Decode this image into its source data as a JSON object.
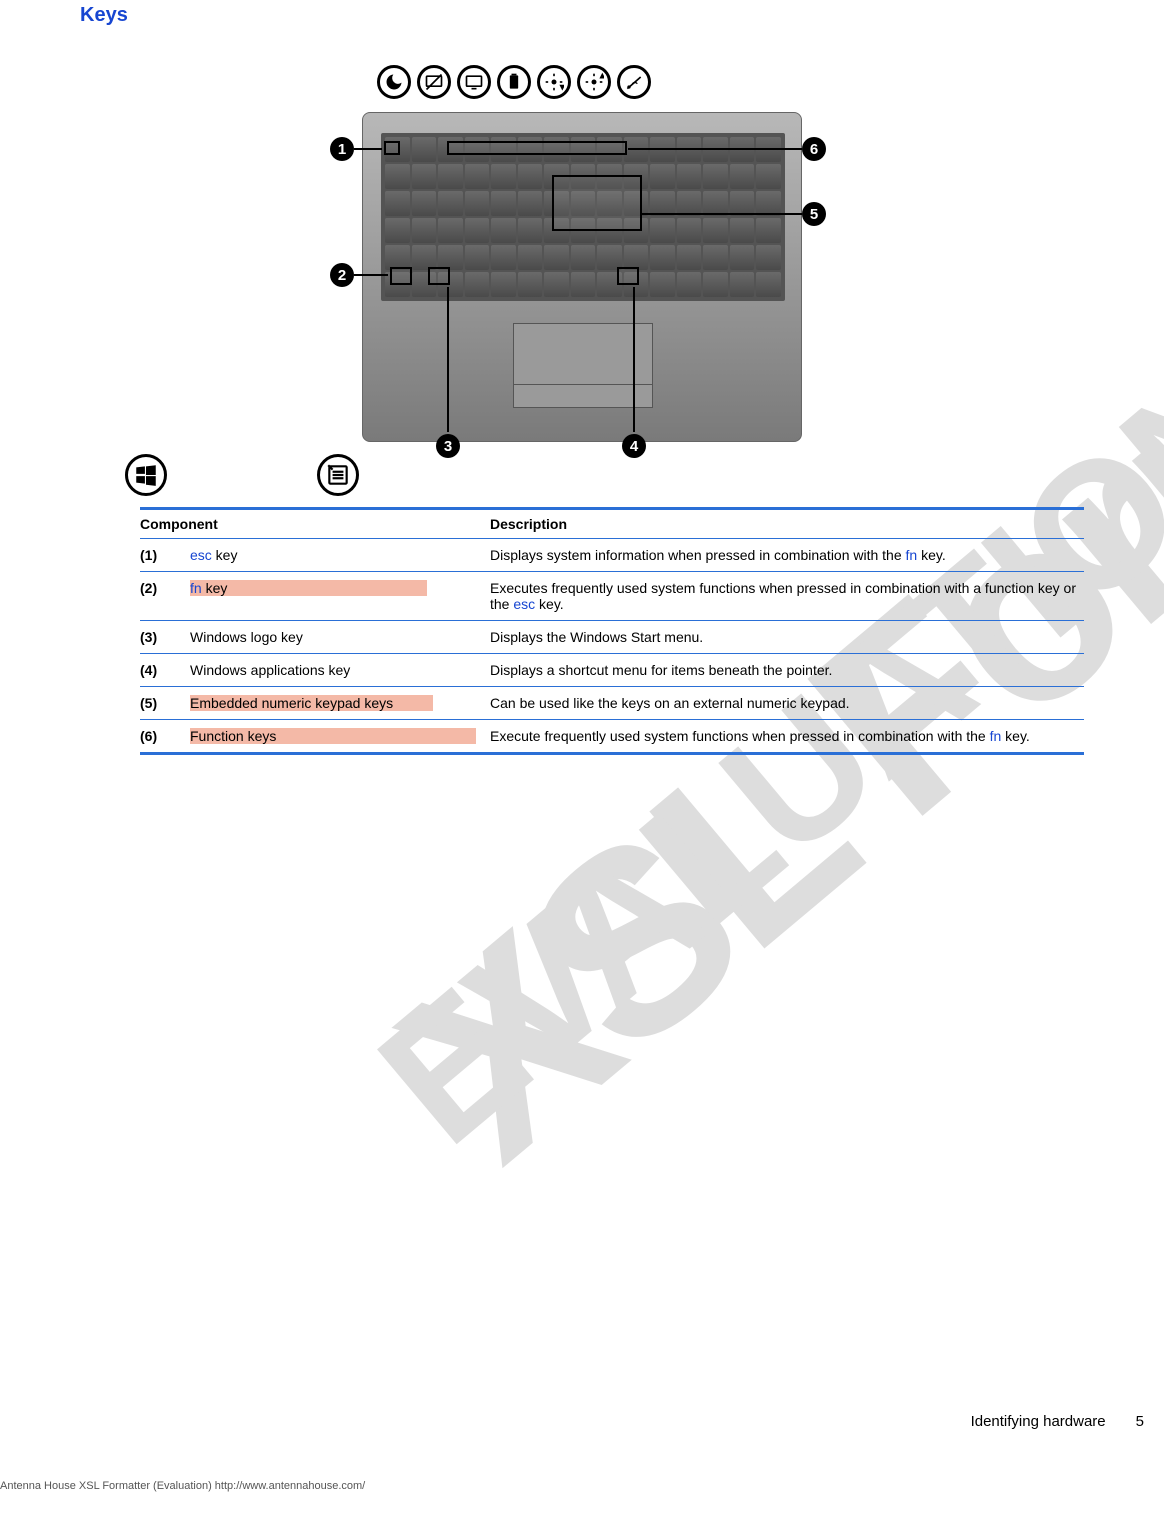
{
  "section_title": "Keys",
  "callouts": {
    "1": "1",
    "2": "2",
    "3": "3",
    "4": "4",
    "5": "5",
    "6": "6"
  },
  "bubble_icons": [
    "moon",
    "display-off",
    "display",
    "battery",
    "brightness-down",
    "brightness-up",
    "wireless"
  ],
  "big_icons": [
    "windows-logo",
    "context-menu"
  ],
  "table": {
    "headers": {
      "component": "Component",
      "description": "Description"
    },
    "rows": [
      {
        "num": "(1)",
        "comp_segments": [
          {
            "text": "esc",
            "link": true,
            "hl": false
          },
          {
            "text": " key",
            "link": false,
            "hl": false
          }
        ],
        "desc_segments": [
          {
            "text": "Displays system information when pressed in combination with the ",
            "link": false,
            "hl": false
          },
          {
            "text": "fn",
            "link": true,
            "hl": false
          },
          {
            "text": " key.",
            "link": false,
            "hl": false
          }
        ]
      },
      {
        "num": "(2)",
        "comp_segments": [
          {
            "text": "fn",
            "link": true,
            "hl": true
          },
          {
            "text": " key",
            "link": false,
            "hl": true
          }
        ],
        "desc_segments": [
          {
            "text": "Executes frequently used system functions when pressed in combination with a function key or the ",
            "link": false,
            "hl": false
          },
          {
            "text": "esc",
            "link": true,
            "hl": false
          },
          {
            "text": " key.",
            "link": false,
            "hl": false
          }
        ]
      },
      {
        "num": "(3)",
        "comp_segments": [
          {
            "text": "Windows logo key",
            "link": false,
            "hl": false
          }
        ],
        "desc_segments": [
          {
            "text": "Displays the Windows Start menu.",
            "link": false,
            "hl": false
          }
        ]
      },
      {
        "num": "(4)",
        "comp_segments": [
          {
            "text": "Windows applications key",
            "link": false,
            "hl": false
          }
        ],
        "desc_segments": [
          {
            "text": "Displays a shortcut menu for items beneath the pointer.",
            "link": false,
            "hl": false
          }
        ]
      },
      {
        "num": "(5)",
        "comp_segments": [
          {
            "text": "Embedded numeric keypad keys",
            "link": false,
            "hl": true
          }
        ],
        "desc_segments": [
          {
            "text": "Can be used like the keys on an external numeric keypad.",
            "link": false,
            "hl": false
          }
        ]
      },
      {
        "num": "(6)",
        "comp_segments": [
          {
            "text": "Function keys",
            "link": false,
            "hl": true
          }
        ],
        "desc_segments": [
          {
            "text": "Execute frequently used system functions when pressed in combination with the ",
            "link": false,
            "hl": false
          },
          {
            "text": "fn",
            "link": true,
            "hl": false
          },
          {
            "text": " key.",
            "link": false,
            "hl": false
          }
        ]
      }
    ]
  },
  "footer": {
    "section": "Identifying hardware",
    "page": "5",
    "eval": "Antenna House XSL Formatter (Evaluation)  http://www.antennahouse.com/"
  }
}
